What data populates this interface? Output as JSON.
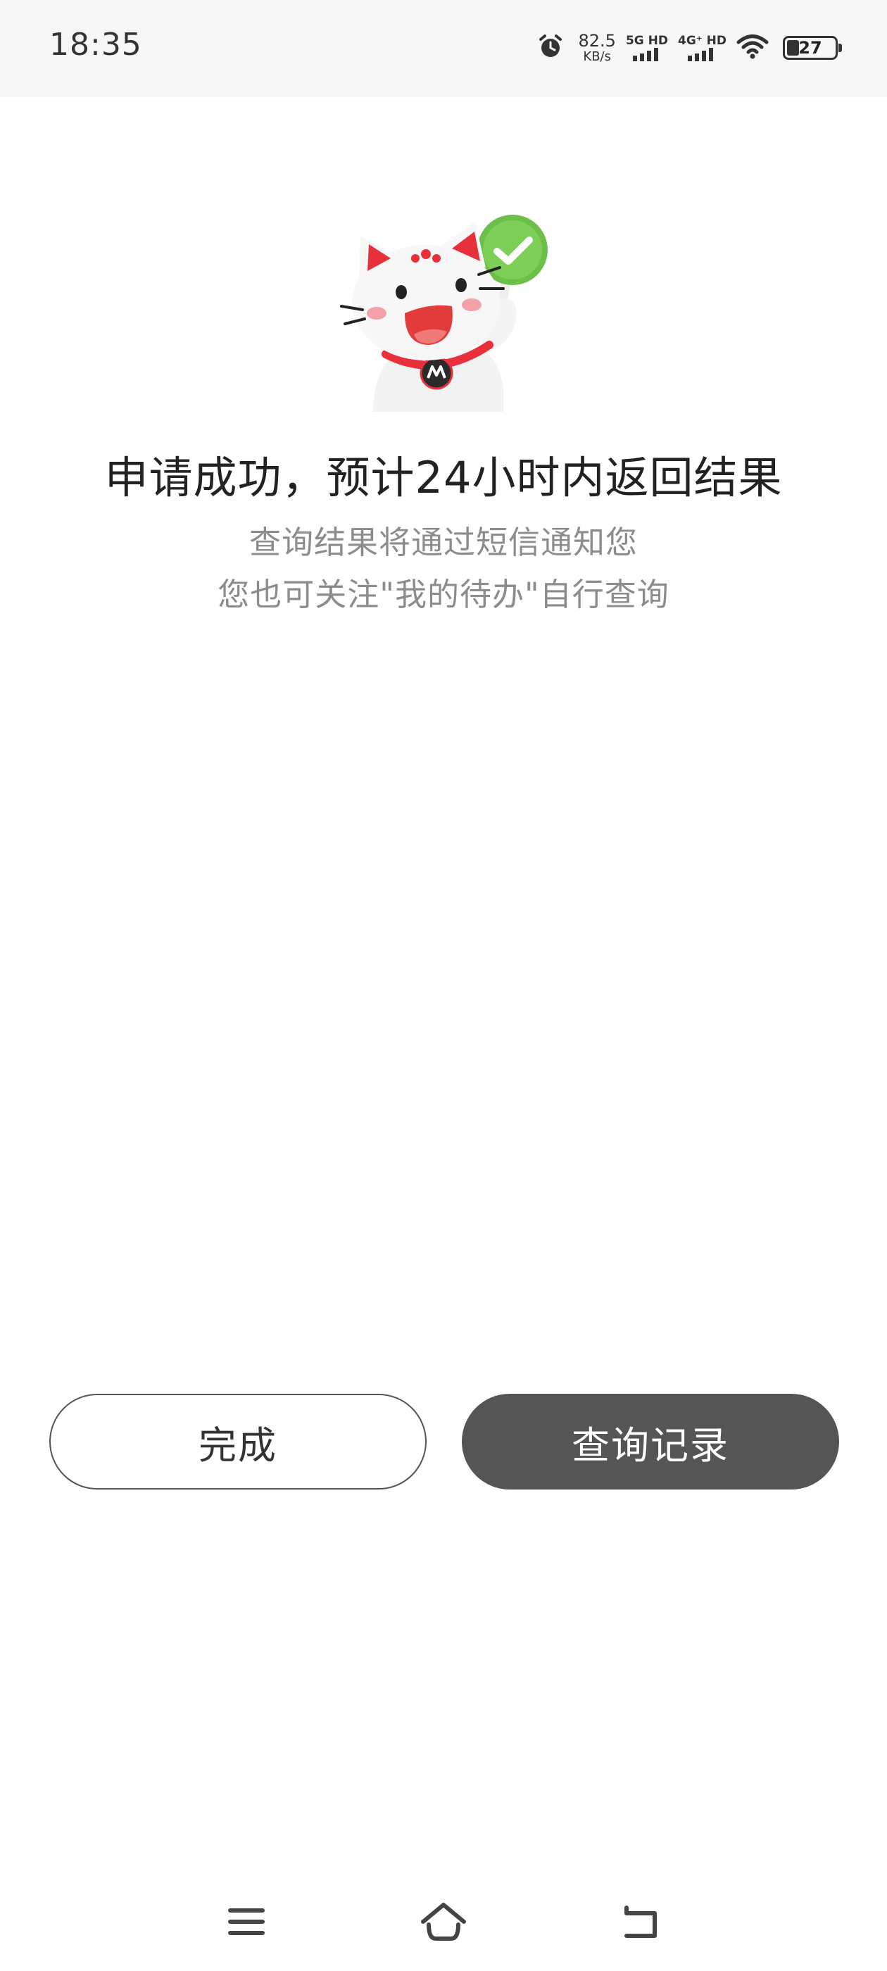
{
  "status_bar": {
    "time": "18:35",
    "speed_value": "82.5",
    "speed_unit": "KB/s",
    "network_1": "5G HD",
    "network_2": "4G⁺ HD",
    "battery_level": "27"
  },
  "result": {
    "title": "申请成功，预计24小时内返回结果",
    "line1": "查询结果将通过短信通知您",
    "line2": "您也可关注\"我的待办\"自行查询"
  },
  "actions": {
    "done_label": "完成",
    "query_label": "查询记录"
  },
  "colors": {
    "primary_button": "#555555",
    "success_green": "#6cc04a",
    "mascot_red": "#e8303a"
  },
  "nav_icons": [
    "menu-icon",
    "home-icon",
    "back-icon"
  ]
}
